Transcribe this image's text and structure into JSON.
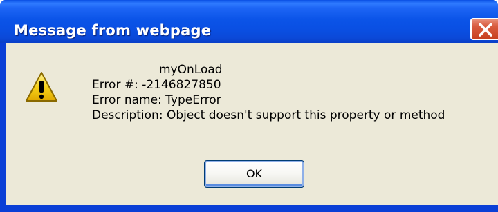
{
  "window": {
    "title": "Message from webpage",
    "close_icon": "close-icon"
  },
  "dialog": {
    "icon": "warning-icon",
    "lines": [
      "myOnLoad",
      "Error #: -2146827850",
      "Error name: TypeError",
      "Description: Object doesn't support this property or method"
    ],
    "ok_label": "OK"
  },
  "colors": {
    "titlebar": "#0b54e8",
    "client": "#ece9d8",
    "close_button": "#d95c3f",
    "warning": "#f5c400"
  }
}
